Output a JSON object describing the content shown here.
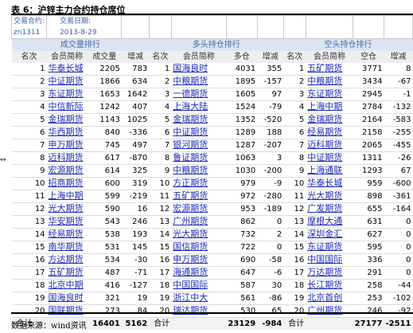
{
  "title": "表 6：沪锌主力合约持仓席位",
  "info": {
    "contract_label": "交易合约:",
    "contract_value": "zn1311",
    "date_label": "交易日期:",
    "date_value": "2013-8-29"
  },
  "sections": {
    "volume": "成交量排行",
    "long": "多头持仓排行",
    "short": "空头持仓排行"
  },
  "headers": [
    "名次",
    "会员简称",
    "成交量",
    "增减",
    "名次",
    "会员简称",
    "多仓",
    "增减",
    "名次",
    "会员简称",
    "空仓",
    "增减"
  ],
  "rows": [
    [
      "1",
      "华泰长城",
      "2205",
      "783",
      "1",
      "国海良时",
      "4031",
      "355",
      "1",
      "五矿期货",
      "3771",
      "8"
    ],
    [
      "2",
      "中证期货",
      "1866",
      "634",
      "2",
      "中粮期货",
      "1895",
      "-157",
      "2",
      "中粮期货",
      "3434",
      "-67"
    ],
    [
      "3",
      "东证期货",
      "1653",
      "1642",
      "3",
      "一德期货",
      "1605",
      "97",
      "3",
      "东证期货",
      "2945",
      "-1"
    ],
    [
      "4",
      "中信新际",
      "1242",
      "407",
      "4",
      "上海大陆",
      "1524",
      "-79",
      "4",
      "上海中期",
      "2784",
      "-132"
    ],
    [
      "5",
      "金瑞期货",
      "1143",
      "1025",
      "5",
      "金瑞期货",
      "1352",
      "-520",
      "5",
      "金瑞期货",
      "2164",
      "-583"
    ],
    [
      "6",
      "华西期货",
      "840",
      "-336",
      "6",
      "中证期货",
      "1289",
      "188",
      "6",
      "经易期货",
      "2158",
      "-255"
    ],
    [
      "7",
      "申万期货",
      "745",
      "497",
      "7",
      "银河期货",
      "1287",
      "-207",
      "7",
      "迈科期货",
      "2065",
      "-455"
    ],
    [
      "8",
      "迈科期货",
      "617",
      "-870",
      "8",
      "鲁证期货",
      "1063",
      "3",
      "8",
      "中证期货",
      "1311",
      "-26"
    ],
    [
      "9",
      "宏源期货",
      "614",
      "325",
      "9",
      "中粮期货",
      "1030",
      "-200",
      "9",
      "上海通联",
      "1293",
      "67"
    ],
    [
      "10",
      "招商期货",
      "600",
      "319",
      "10",
      "方正期货",
      "979",
      "-9",
      "10",
      "华泰长城",
      "959",
      "-600"
    ],
    [
      "11",
      "上海中期",
      "599",
      "-219",
      "11",
      "五矿期货",
      "972",
      "-280",
      "11",
      "光大期货",
      "898",
      "-361"
    ],
    [
      "12",
      "光大期货",
      "590",
      "16",
      "12",
      "宏源期货",
      "953",
      "-189",
      "12",
      "广发期货",
      "655",
      "-164"
    ],
    [
      "13",
      "华安期货",
      "543",
      "246",
      "13",
      "广州期货",
      "862",
      "0",
      "13",
      "摩根大通",
      "631",
      "0"
    ],
    [
      "14",
      "经易期货",
      "538",
      "193",
      "14",
      "光大期货",
      "732",
      "2",
      "14",
      "深圳金汇",
      "627",
      "0"
    ],
    [
      "15",
      "南华期货",
      "531",
      "145",
      "15",
      "国信期货",
      "722",
      "0",
      "15",
      "东证期货",
      "595",
      "0"
    ],
    [
      "16",
      "方达期货",
      "534",
      "-30",
      "16",
      "申万期货",
      "690",
      "-58",
      "16",
      "中国国际",
      "336",
      "0"
    ],
    [
      "17",
      "五矿期货",
      "487",
      "-71",
      "17",
      "海通期货",
      "647",
      "-6",
      "17",
      "万达期货",
      "291",
      "0"
    ],
    [
      "18",
      "北京中期",
      "416",
      "-127",
      "18",
      "中国国际",
      "587",
      "30",
      "18",
      "长江期货",
      "258",
      "-44"
    ],
    [
      "19",
      "国海良时",
      "321",
      "19",
      "19",
      "浙江中大",
      "561",
      "-86",
      "19",
      "北京首创",
      "253",
      "-102"
    ],
    [
      "20",
      "国联期货",
      "273",
      "84",
      "20",
      "瑞达期货",
      "530",
      "65",
      "20",
      "广州期货",
      "246",
      "-92"
    ]
  ],
  "totals": {
    "label": "合计",
    "volume": "16401",
    "volume_change": "5162",
    "long": "23129",
    "long_change": "-984",
    "short": "27177",
    "short_change": "-2511"
  },
  "source": "数据来源：wind资讯"
}
